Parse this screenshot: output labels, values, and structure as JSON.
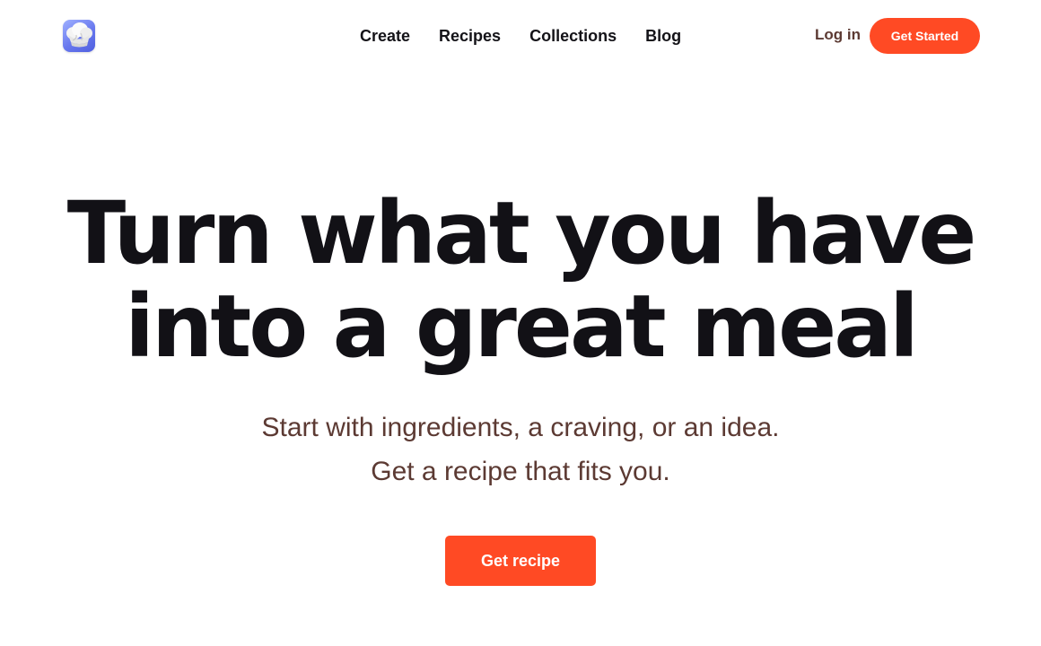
{
  "header": {
    "logo_icon": "chef-hat-icon",
    "nav": [
      {
        "label": "Create"
      },
      {
        "label": "Recipes"
      },
      {
        "label": "Collections"
      },
      {
        "label": "Blog"
      }
    ],
    "login_label": "Log in",
    "get_started_label": "Get Started"
  },
  "hero": {
    "title_line1": "Turn what you have",
    "title_line2": "into a great meal",
    "subtitle_line1": "Start with ingredients, a craving, or an idea.",
    "subtitle_line2": "Get a recipe that fits you.",
    "cta_label": "Get recipe"
  },
  "colors": {
    "accent": "#ff4a24",
    "heading": "#121116",
    "body_text": "#5c3a33",
    "logo_bg": "#6878ee"
  }
}
